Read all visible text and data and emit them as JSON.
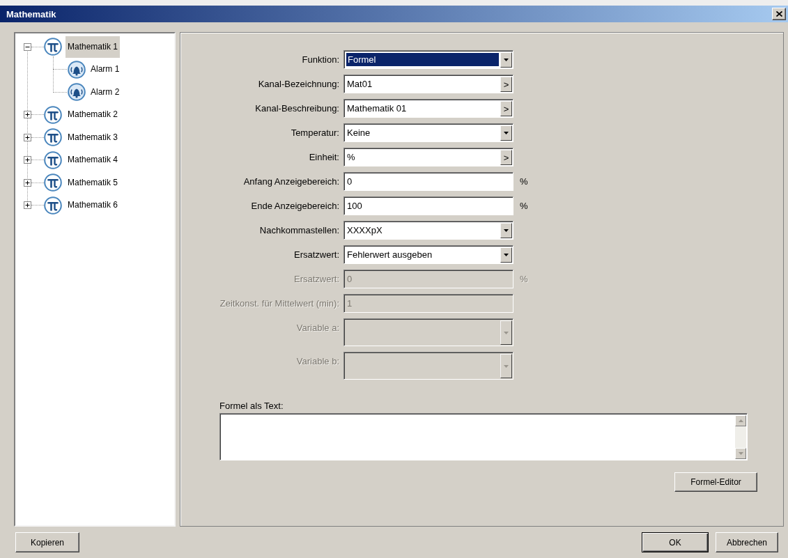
{
  "window": {
    "title": "Mathematik"
  },
  "tree": [
    {
      "label": "Mathematik 1",
      "selected": true,
      "expanded": true,
      "children": [
        {
          "label": "Alarm 1",
          "selected": false
        },
        {
          "label": "Alarm 2",
          "selected": false
        }
      ]
    },
    {
      "label": "Mathematik 2",
      "selected": false,
      "expanded": false
    },
    {
      "label": "Mathematik 3",
      "selected": false,
      "expanded": false
    },
    {
      "label": "Mathematik 4",
      "selected": false,
      "expanded": false
    },
    {
      "label": "Mathematik 5",
      "selected": false,
      "expanded": false
    },
    {
      "label": "Mathematik 6",
      "selected": false,
      "expanded": false
    }
  ],
  "form": {
    "fields": [
      {
        "label": "Funktion:",
        "kind": "dropdown",
        "value": "Formel",
        "highlighted": true,
        "disabled": false
      },
      {
        "label": "Kanal-Bezeichnung:",
        "kind": "picker",
        "value": "Mat01",
        "button": ">",
        "highlighted": false,
        "disabled": false
      },
      {
        "label": "Kanal-Beschreibung:",
        "kind": "picker",
        "value": "Mathematik 01",
        "button": ">",
        "highlighted": false,
        "disabled": false
      },
      {
        "label": "Temperatur:",
        "kind": "dropdown",
        "value": "Keine",
        "highlighted": false,
        "disabled": false
      },
      {
        "label": "Einheit:",
        "kind": "picker",
        "value": "%",
        "button": ">",
        "highlighted": false,
        "disabled": false
      },
      {
        "label": "Anfang Anzeigebereich:",
        "kind": "text",
        "value": "0",
        "unit": "%",
        "highlighted": false,
        "disabled": false
      },
      {
        "label": "Ende Anzeigebereich:",
        "kind": "text",
        "value": "100",
        "unit": "%",
        "highlighted": false,
        "disabled": false
      },
      {
        "label": "Nachkommastellen:",
        "kind": "dropdown",
        "value": "XXXXpX",
        "highlighted": false,
        "disabled": false
      },
      {
        "label": "Ersatzwert:",
        "kind": "dropdown",
        "value": "Fehlerwert ausgeben",
        "highlighted": false,
        "disabled": false
      },
      {
        "label": "Ersatzwert:",
        "kind": "text",
        "value": "0",
        "unit": "%",
        "highlighted": false,
        "disabled": true
      },
      {
        "label": "Zeitkonst. für Mittelwert (min):",
        "kind": "text",
        "value": "1",
        "highlighted": false,
        "disabled": true
      },
      {
        "label": "Variable a:",
        "kind": "combobox",
        "highlighted": false,
        "disabled": true
      },
      {
        "label": "Variable b:",
        "kind": "combobox",
        "highlighted": false,
        "disabled": true
      }
    ],
    "formula": {
      "label": "Formel als Text:",
      "editor_button": "Formel-Editor"
    }
  },
  "footer": {
    "copy_button": "Kopieren",
    "buttons": [
      {
        "label": "OK",
        "default": true
      },
      {
        "label": "Abbrechen",
        "default": false
      }
    ]
  }
}
